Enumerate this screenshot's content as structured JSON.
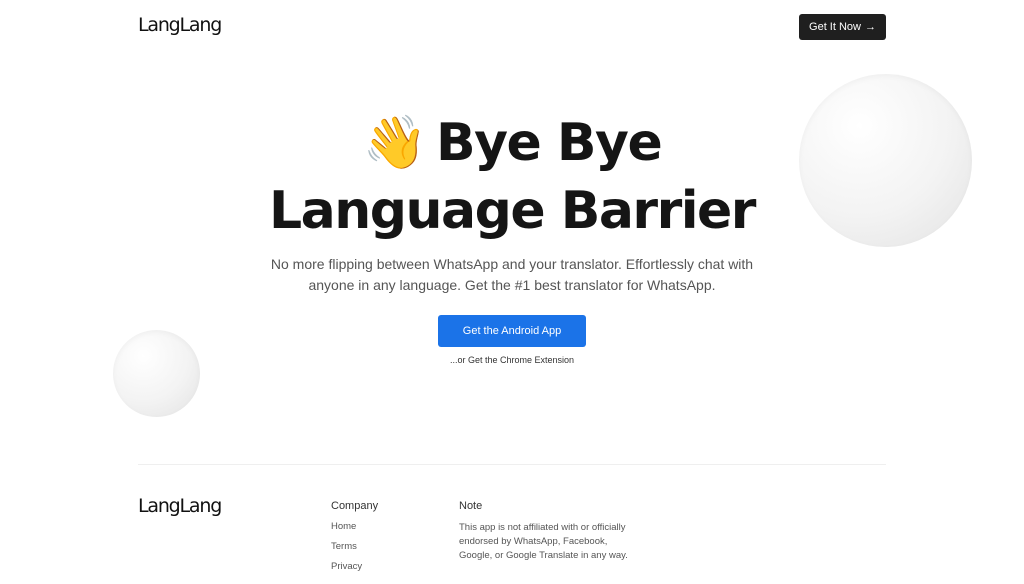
{
  "header": {
    "logo": "LangLang",
    "cta_label": "Get It Now",
    "cta_arrow": "→"
  },
  "hero": {
    "emoji": "👋",
    "title_line1": "Bye Bye",
    "title_line2": "Language Barrier",
    "subtitle": "No more flipping between WhatsApp and your translator. Effortlessly chat with anyone in any language. Get the #1 best translator for WhatsApp.",
    "primary_button": "Get the Android App",
    "secondary_link": "...or Get the Chrome Extension"
  },
  "footer": {
    "logo": "LangLang",
    "company": {
      "heading": "Company",
      "links": [
        "Home",
        "Terms",
        "Privacy"
      ]
    },
    "note": {
      "heading": "Note",
      "text": "This app is not affiliated with or officially endorsed by WhatsApp, Facebook, Google, or Google Translate in any way."
    }
  },
  "colors": {
    "primary_button": "#1b73e8",
    "cta_background": "#1f1f1f",
    "text": "#151515"
  }
}
